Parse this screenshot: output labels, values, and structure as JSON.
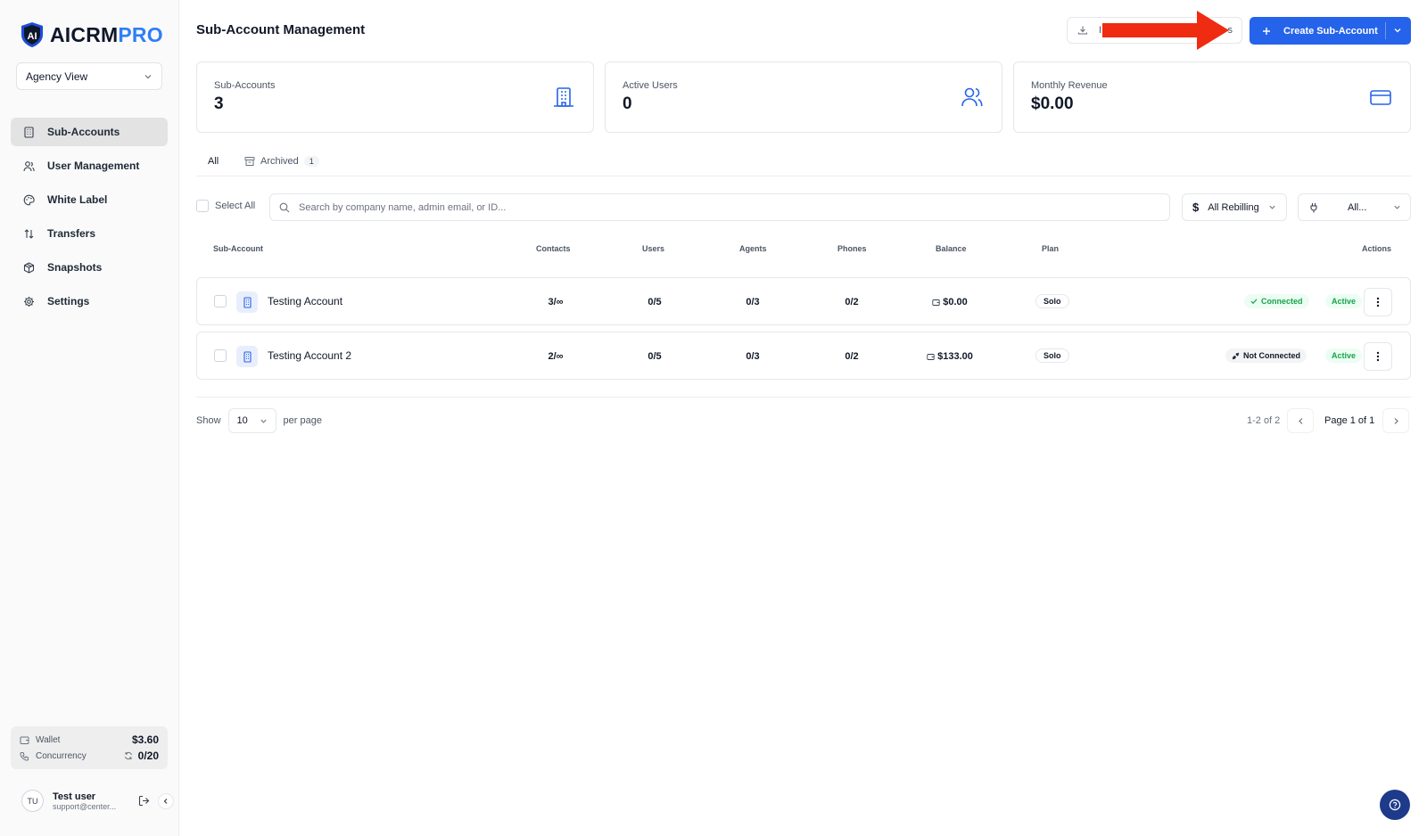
{
  "brand": {
    "name_main": "AICRM",
    "name_accent": "PRO",
    "accent_color": "#2f7ef6"
  },
  "sidebar": {
    "view_select": "Agency View",
    "items": [
      {
        "label": "Sub-Accounts",
        "icon": "building-icon",
        "active": true
      },
      {
        "label": "User Management",
        "icon": "users-icon",
        "active": false
      },
      {
        "label": "White Label",
        "icon": "palette-icon",
        "active": false
      },
      {
        "label": "Transfers",
        "icon": "arrows-updown-icon",
        "active": false
      },
      {
        "label": "Snapshots",
        "icon": "package-icon",
        "active": false
      },
      {
        "label": "Settings",
        "icon": "gear-icon",
        "active": false
      }
    ],
    "wallet": {
      "label": "Wallet",
      "value": "$3.60"
    },
    "concurrency": {
      "label": "Concurrency",
      "value": "0/20"
    },
    "user": {
      "initials": "TU",
      "name": "Test user",
      "email": "support@center..."
    }
  },
  "header": {
    "title": "Sub-Account Management",
    "import_label": "I",
    "import_tail": "s",
    "create_label": "Create Sub-Account",
    "primary_color": "#2563eb"
  },
  "stats": [
    {
      "label": "Sub-Accounts",
      "value": "3",
      "icon": "building-icon"
    },
    {
      "label": "Active Users",
      "value": "0",
      "icon": "users-icon"
    },
    {
      "label": "Monthly Revenue",
      "value": "$0.00",
      "icon": "credit-card-icon"
    }
  ],
  "tabs": {
    "all": "All",
    "archived": "Archived",
    "archived_count": "1"
  },
  "toolbar": {
    "select_all": "Select All",
    "search_placeholder": "Search by company name, admin email, or ID...",
    "rebilling_filter": "All Rebilling",
    "connection_filter": "All..."
  },
  "table": {
    "columns": [
      "Sub-Account",
      "Contacts",
      "Users",
      "Agents",
      "Phones",
      "Balance",
      "Plan",
      "Actions"
    ],
    "rows": [
      {
        "name": "Testing Account",
        "contacts": "3/∞",
        "users": "0/5",
        "agents": "0/3",
        "phones": "0/2",
        "balance": "$0.00",
        "plan": "Solo",
        "connection": "Connected",
        "status": "Active"
      },
      {
        "name": "Testing Account 2",
        "contacts": "2/∞",
        "users": "0/5",
        "agents": "0/3",
        "phones": "0/2",
        "balance": "$133.00",
        "plan": "Solo",
        "connection": "Not Connected",
        "status": "Active"
      }
    ]
  },
  "pagination": {
    "show_label": "Show",
    "per_page_value": "10",
    "per_page_label": "per page",
    "range": "1-2 of 2",
    "page_label": "Page 1 of 1"
  }
}
